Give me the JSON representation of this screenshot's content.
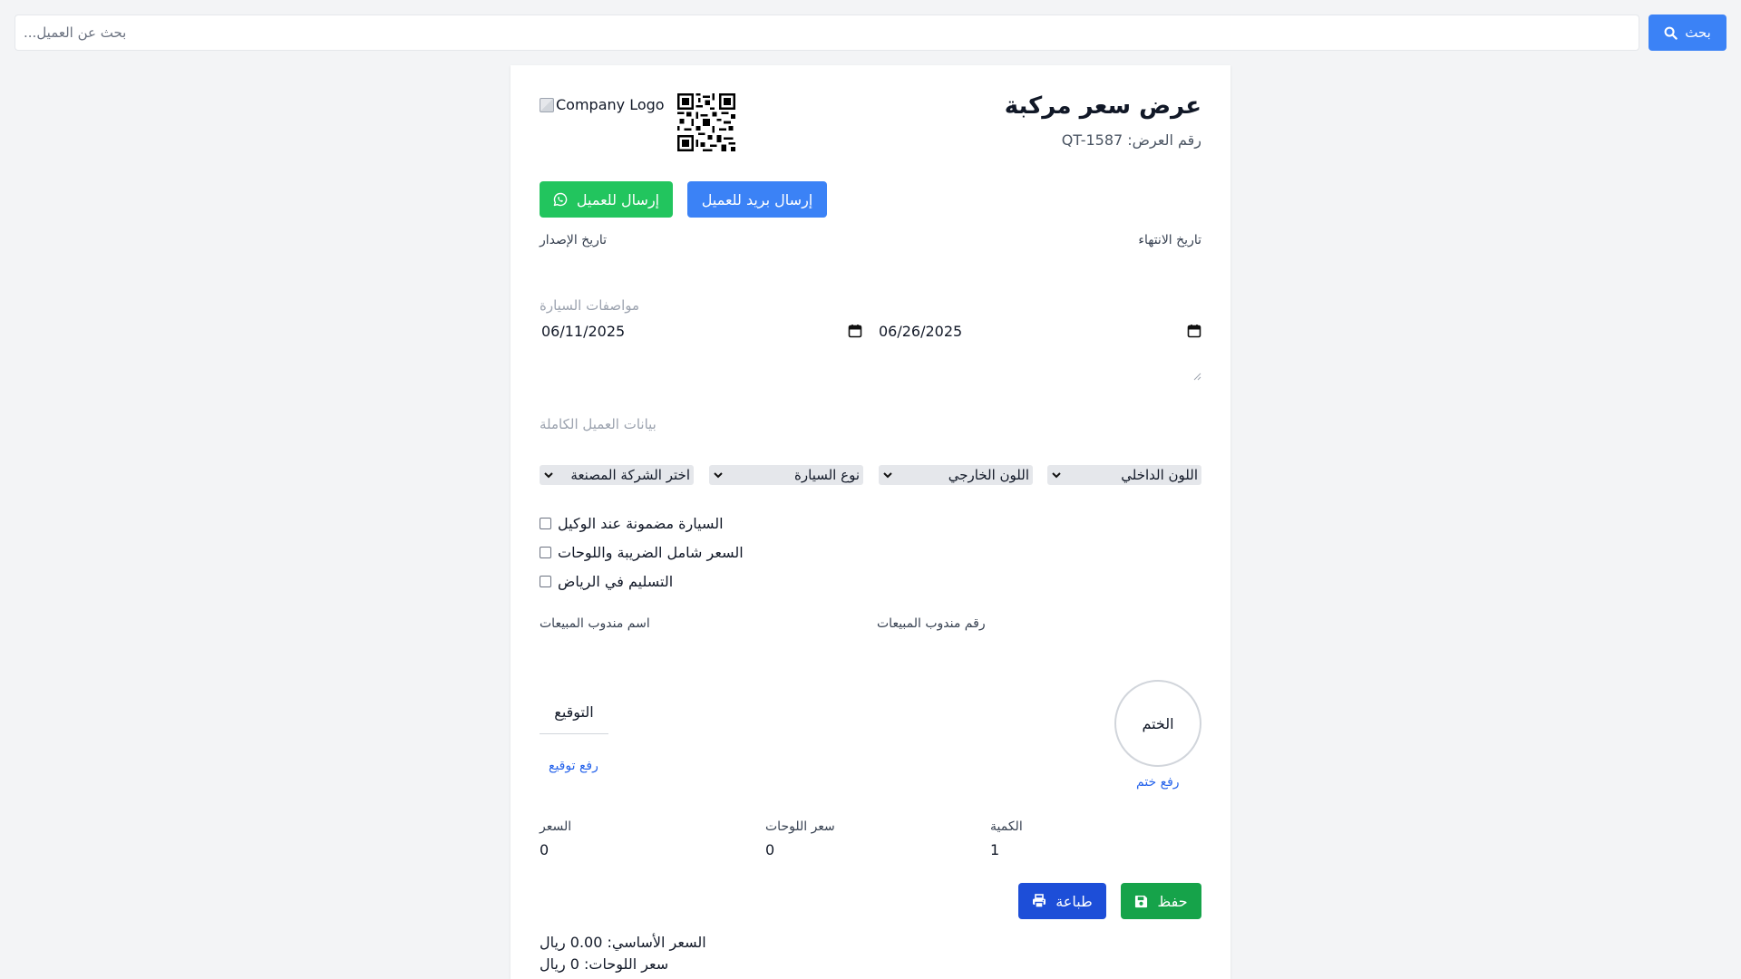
{
  "search": {
    "placeholder": "...بحث عن العميل",
    "button_label": "بحث"
  },
  "header": {
    "title": "عرض سعر مركبة",
    "quote_number": "QT-1587 :رقم العرض",
    "logo_alt": "Company Logo"
  },
  "actions": {
    "whatsapp_label": "إرسال للعميل",
    "email_label": "إرسال بريد للعميل"
  },
  "dates": {
    "issue_label": "تاريخ الإصدار",
    "issue_value": "06/11/2025",
    "expiry_label": "تاريخ الانتهاء",
    "expiry_value": "06/26/2025"
  },
  "fields": {
    "car_specs_placeholder": "مواصفات السيارة",
    "customer_data_placeholder": "بيانات العميل الكاملة"
  },
  "selects": {
    "interior_color": "اللون الداخلي",
    "exterior_color": "اللون الخارجي",
    "car_type": "نوع السيارة",
    "manufacturer": "اختر الشركة المصنعة"
  },
  "checks": [
    "السيارة مضمونة عند الوكيل",
    "السعر شامل الضريبة واللوحات",
    "التسليم في الرياض"
  ],
  "sales": {
    "name_label": "اسم مندوب المبيعات",
    "number_label": "رقم مندوب المبيعات"
  },
  "stamp": {
    "label": "الختم",
    "upload": "رفع ختم"
  },
  "signature": {
    "label": "التوقيع",
    "upload": "رفع توقيع"
  },
  "pricing": {
    "price_label": "السعر",
    "price_value": "0",
    "plates_label": "سعر اللوحات",
    "plates_value": "0",
    "qty_label": "الكمية",
    "qty_value": "1"
  },
  "buttons": {
    "save": "حفظ",
    "print": "طباعة"
  },
  "summary": {
    "base_price": "السعر الأساسي: 0.00 ريال",
    "plates_price": "سعر اللوحات: 0 ريال"
  },
  "colors": {
    "primary": "#3b82f6",
    "whatsapp": "#22c55e",
    "save": "#16a34a",
    "print": "#1d4ed8",
    "link": "#2563eb"
  }
}
